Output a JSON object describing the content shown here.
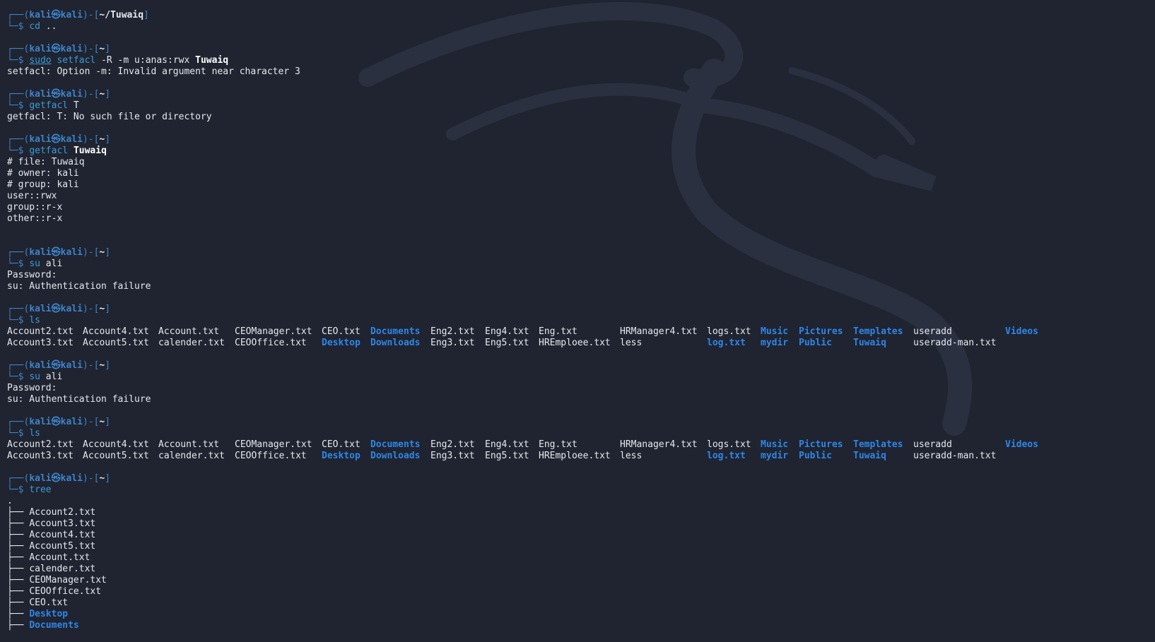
{
  "colors": {
    "background": "#1f2430",
    "prompt_blue": "#3f83c9",
    "dir_blue": "#2f86e8",
    "text": "#e6e8ee"
  },
  "prompt": {
    "user": "kali",
    "host": "kali",
    "symbol": "㉿"
  },
  "blocks": [
    {
      "path": "~/Tuwaiq",
      "cmd": "cd",
      "args": "..",
      "output": []
    },
    {
      "path": "~",
      "sudo": "sudo",
      "cmd": "setfacl",
      "args": "-R -m u:anas:rwx",
      "argb": "Tuwaiq",
      "output": [
        "setfacl: Option -m: Invalid argument near character 3"
      ]
    },
    {
      "path": "~",
      "cmd": "getfacl",
      "args": "T",
      "output": [
        "getfacl: T: No such file or directory"
      ]
    },
    {
      "path": "~",
      "cmd": "getfacl",
      "argb": "Tuwaiq",
      "output": [
        "# file: Tuwaiq",
        "# owner: kali",
        "# group: kali",
        "user::rwx",
        "group::r-x",
        "other::r-x"
      ]
    },
    {
      "path": "~",
      "cmd": "su",
      "args": "ali",
      "output": [
        "Password:",
        "su: Authentication failure"
      ]
    },
    {
      "path": "~",
      "cmd": "ls",
      "ls": true
    },
    {
      "path": "~",
      "cmd": "su",
      "args": "ali",
      "output": [
        "Password:",
        "su: Authentication failure"
      ]
    },
    {
      "path": "~",
      "cmd": "ls",
      "ls": true
    },
    {
      "path": "~",
      "cmd": "tree",
      "tree": true
    }
  ],
  "ls_columns": [
    [
      {
        "t": "Account2.txt"
      },
      {
        "t": "Account3.txt"
      }
    ],
    [
      {
        "t": "Account4.txt"
      },
      {
        "t": "Account5.txt"
      }
    ],
    [
      {
        "t": "Account.txt"
      },
      {
        "t": "calender.txt"
      }
    ],
    [
      {
        "t": "CEOManager.txt"
      },
      {
        "t": "CEOOffice.txt"
      }
    ],
    [
      {
        "t": "CEO.txt"
      },
      {
        "t": "Desktop",
        "d": true
      }
    ],
    [
      {
        "t": "Documents",
        "d": true
      },
      {
        "t": "Downloads",
        "d": true
      }
    ],
    [
      {
        "t": "Eng2.txt"
      },
      {
        "t": "Eng3.txt"
      }
    ],
    [
      {
        "t": "Eng4.txt"
      },
      {
        "t": "Eng5.txt"
      }
    ],
    [
      {
        "t": "Eng.txt"
      },
      {
        "t": "HREmploee.txt"
      }
    ],
    [
      {
        "t": "HRManager4.txt"
      },
      {
        "t": "less"
      }
    ],
    [
      {
        "t": "logs.txt"
      },
      {
        "t": "log.txt",
        "d": true
      }
    ],
    [
      {
        "t": "Music",
        "d": true
      },
      {
        "t": "mydir",
        "d": true
      }
    ],
    [
      {
        "t": "Pictures",
        "d": true
      },
      {
        "t": "Public",
        "d": true
      }
    ],
    [
      {
        "t": "Templates",
        "d": true
      },
      {
        "t": "Tuwaiq",
        "d": true
      }
    ],
    [
      {
        "t": "useradd"
      },
      {
        "t": "useradd-man.txt"
      }
    ],
    [
      {
        "t": "Videos",
        "d": true
      },
      {
        "t": ""
      }
    ]
  ],
  "tree": {
    "root": ".",
    "items": [
      {
        "t": "Account2.txt"
      },
      {
        "t": "Account3.txt"
      },
      {
        "t": "Account4.txt"
      },
      {
        "t": "Account5.txt"
      },
      {
        "t": "Account.txt"
      },
      {
        "t": "calender.txt"
      },
      {
        "t": "CEOManager.txt"
      },
      {
        "t": "CEOOffice.txt"
      },
      {
        "t": "CEO.txt"
      },
      {
        "t": "Desktop",
        "d": true
      },
      {
        "t": "Documents",
        "d": true
      }
    ]
  }
}
